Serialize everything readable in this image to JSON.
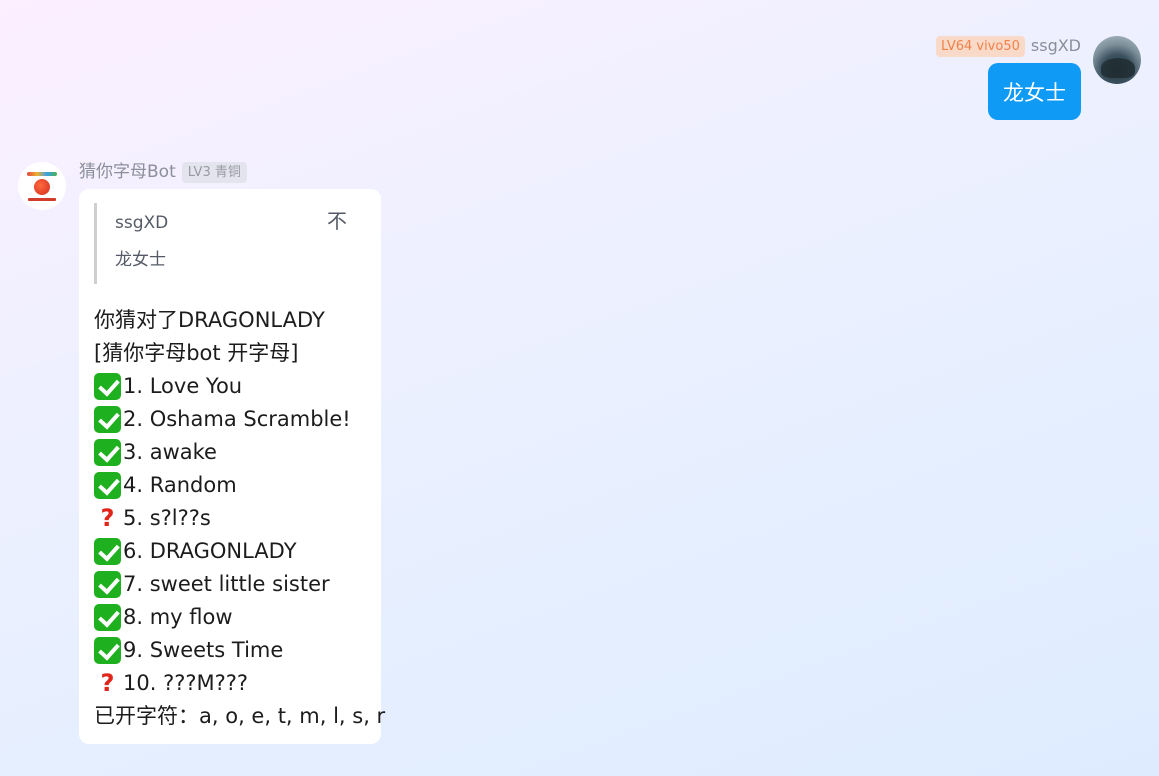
{
  "self_message": {
    "badge": "LV64 vivo50",
    "name": "ssgXD",
    "text": "龙女士"
  },
  "bot_message": {
    "name": "猜你字母Bot",
    "badge": "LV3 青铜",
    "reply": {
      "author": "ssgXD",
      "text": "龙女士",
      "jump_icon": "不"
    },
    "lines": [
      {
        "icon": "",
        "text": "你猜对了DRAGONLADY"
      },
      {
        "icon": "",
        "text": "[猜你字母bot 开字母]"
      },
      {
        "icon": "check-icon",
        "text": "1. Love You"
      },
      {
        "icon": "check-icon",
        "text": "2. Oshama Scramble!"
      },
      {
        "icon": "check-icon",
        "text": "3. awake"
      },
      {
        "icon": "check-icon",
        "text": "4. Random"
      },
      {
        "icon": "question-icon",
        "text": "5. s?l??s"
      },
      {
        "icon": "check-icon",
        "text": "6. DRAGONLADY"
      },
      {
        "icon": "check-icon",
        "text": "7. sweet little sister"
      },
      {
        "icon": "check-icon",
        "text": "8. my flow"
      },
      {
        "icon": "check-icon",
        "text": "9. Sweets Time"
      },
      {
        "icon": "question-icon",
        "text": "10. ???M???"
      },
      {
        "icon": "",
        "text": "已开字符：a, o, e, t, m, l, s, r"
      }
    ]
  },
  "colors": {
    "self_bubble": "#0f9bf5",
    "check": "#1fb01f",
    "question": "#e0251b"
  }
}
